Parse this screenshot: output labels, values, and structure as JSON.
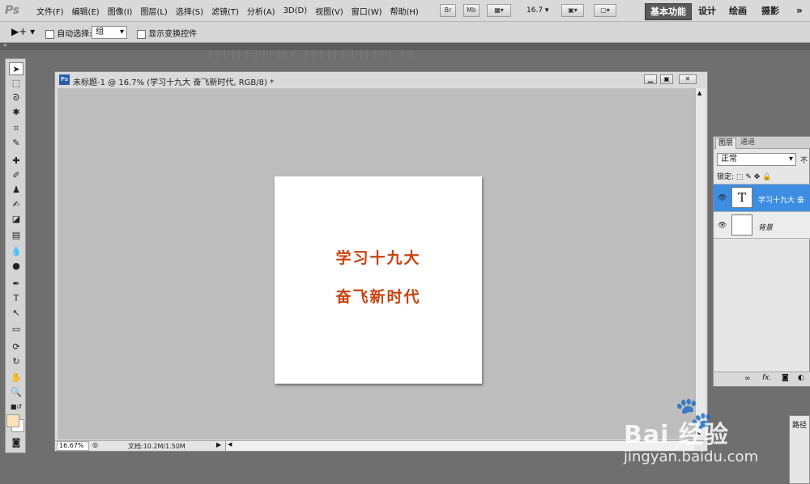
{
  "app": {
    "logo": "Ps"
  },
  "menu": [
    "文件(F)",
    "编辑(E)",
    "图像(I)",
    "图层(L)",
    "选择(S)",
    "滤镜(T)",
    "分析(A)",
    "3D(D)",
    "视图(V)",
    "窗口(W)",
    "帮助(H)"
  ],
  "menubar_buttons": {
    "bridge": "Br",
    "minibridge": "Mb",
    "zoom": "16.7"
  },
  "workspaces": [
    "基本功能",
    "设计",
    "绘画",
    "摄影"
  ],
  "options": {
    "auto_select_label": "自动选择:",
    "auto_select_value": "组",
    "show_transform_label": "显示变换控件"
  },
  "document": {
    "title": "未标题-1 @ 16.7% (学习十九大  奋飞新时代, RGB/8) *",
    "zoom": "16.67%",
    "doc_info": "文档:10.2M/1.50M",
    "canvas_lines": [
      "学习十九大",
      "奋飞新时代"
    ],
    "text_color": "#c8420f"
  },
  "layers_panel": {
    "tabs": [
      "图层",
      "通道"
    ],
    "blend_mode": "正常",
    "opacity_label_partial": "不",
    "lock_label": "锁定:",
    "layers": [
      {
        "name": "学习十九大  奋",
        "type": "text",
        "selected": true
      },
      {
        "name": "背景",
        "type": "background",
        "selected": false
      }
    ],
    "footer_icons": [
      "link-icon",
      "fx-icon",
      "mask-icon",
      "adjustment-icon"
    ],
    "fx_label": "fx."
  },
  "paths_panel": {
    "tab": "路径"
  },
  "watermark": {
    "brand": "Bai  经验",
    "url": "jingyan.baidu.com"
  }
}
